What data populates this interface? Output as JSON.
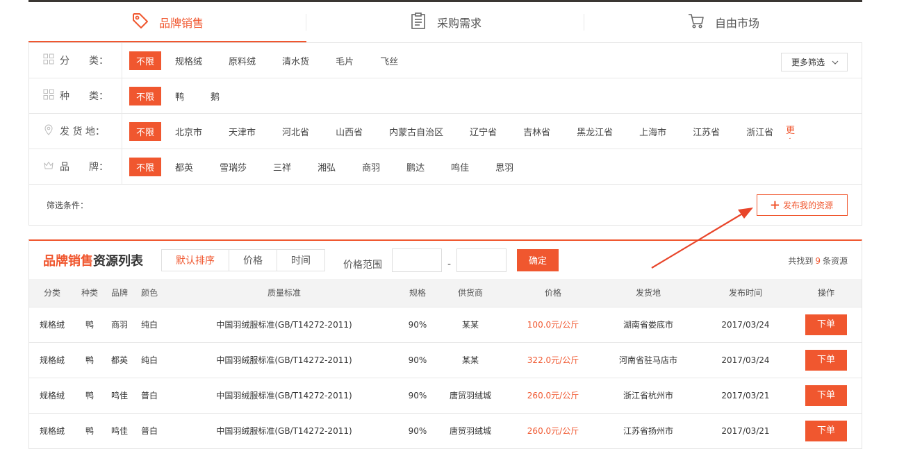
{
  "tabs": [
    {
      "label": "品牌销售",
      "icon": "tag-icon",
      "active": true
    },
    {
      "label": "采购需求",
      "icon": "clipboard-icon",
      "active": false
    },
    {
      "label": "自由市场",
      "icon": "cart-icon",
      "active": false
    }
  ],
  "filters": {
    "category": {
      "label": "分　　类：",
      "options": [
        "不限",
        "规格绒",
        "原料绒",
        "清水货",
        "毛片",
        "飞丝"
      ]
    },
    "species": {
      "label": "种　　类：",
      "options": [
        "不限",
        "鸭",
        "鹅"
      ]
    },
    "origin": {
      "label": "发 货 地：",
      "options": [
        "不限",
        "北京市",
        "天津市",
        "河北省",
        "山西省",
        "内蒙古自治区",
        "辽宁省",
        "吉林省",
        "黑龙江省",
        "上海市",
        "江苏省",
        "浙江省"
      ],
      "more": "更多"
    },
    "brand": {
      "label": "品　　牌：",
      "options": [
        "不限",
        "都英",
        "雪瑞莎",
        "三祥",
        "湘弘",
        "商羽",
        "鹏达",
        "鸣佳",
        "思羽"
      ]
    },
    "more_filter": "更多筛选",
    "conditions_label": "筛选条件：",
    "publish": "发布我的资源"
  },
  "list": {
    "title_highlight": "品牌销售",
    "title_rest": "资源列表",
    "sorts": [
      "默认排序",
      "价格",
      "时间"
    ],
    "price_range_label": "价格范围",
    "price_min": "",
    "price_max": "",
    "confirm": "确定",
    "found_prefix": "共找到",
    "found_count": "9",
    "found_suffix": "条资源",
    "columns": [
      "分类",
      "种类",
      "品牌",
      "颜色",
      "质量标准",
      "规格",
      "供货商",
      "价格",
      "发货地",
      "发布时间",
      "操作"
    ],
    "rows": [
      [
        "规格绒",
        "鸭",
        "商羽",
        "纯白",
        "中国羽绒服标准(GB/T14272-2011)",
        "90%",
        "某某",
        "100.0元/公斤",
        "湖南省娄底市",
        "2017/03/24",
        "下单"
      ],
      [
        "规格绒",
        "鸭",
        "都英",
        "纯白",
        "中国羽绒服标准(GB/T14272-2011)",
        "90%",
        "某某",
        "322.0元/公斤",
        "河南省驻马店市",
        "2017/03/24",
        "下单"
      ],
      [
        "规格绒",
        "鸭",
        "鸣佳",
        "普白",
        "中国羽绒服标准(GB/T14272-2011)",
        "90%",
        "唐贸羽绒城",
        "260.0元/公斤",
        "浙江省杭州市",
        "2017/03/21",
        "下单"
      ],
      [
        "规格绒",
        "鸭",
        "鸣佳",
        "普白",
        "中国羽绒服标准(GB/T14272-2011)",
        "90%",
        "唐贸羽绒城",
        "260.0元/公斤",
        "江苏省扬州市",
        "2017/03/21",
        "下单"
      ]
    ]
  },
  "colors": {
    "accent": "#f0572f",
    "arrow": "#e8452a"
  }
}
